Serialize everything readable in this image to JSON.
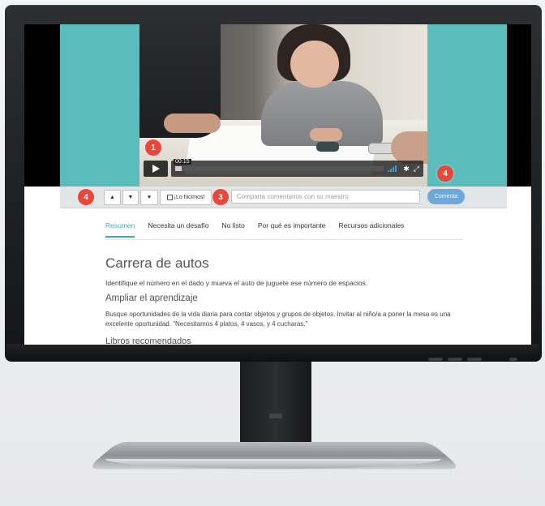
{
  "video": {
    "time": "00:15",
    "play_icon": "play-icon",
    "volume_icon": "volume-icon",
    "settings_icon": "gear-icon",
    "fullscreen_icon": "fullscreen-icon",
    "progress": 0.03
  },
  "toolbar": {
    "like_icon": "thumbs-up-icon",
    "dislike_icon": "thumbs-down-icon",
    "heart_icon": "heart-icon",
    "did_it_label": "¡Lo hicimos!",
    "comment_placeholder": "Comparta comentarios con su maestro",
    "comment_button": "Comenta"
  },
  "annotations": [
    "1",
    "3",
    "4",
    "4"
  ],
  "tabs": [
    {
      "label": "Resumen",
      "active": true
    },
    {
      "label": "Necesita un desafío",
      "active": false
    },
    {
      "label": "No listo",
      "active": false
    },
    {
      "label": "Por qué es importante",
      "active": false
    },
    {
      "label": "Recursos adicionales",
      "active": false
    }
  ],
  "activity": {
    "title": "Carrera de autos",
    "description": "Identifique el número en el dado y mueva el auto de juguete ese número de espacios.",
    "section1_title": "Ampliar el aprendizaje",
    "section1_text": "Busque oportunidades de la vida diaria para contar objetos y grupos de objetos. Invitar al niño/a a poner la mesa es una excelente oportunidad. \"Necesitamos 4 platos, 4 vasos, y 4 cucharas.\"",
    "section2_title": "Libros recomendados"
  },
  "colors": {
    "teal": "#5bbcbc",
    "accent_red": "#e8473a",
    "comment_blue": "#6da8d8",
    "tab_active": "#4aa8a8"
  }
}
